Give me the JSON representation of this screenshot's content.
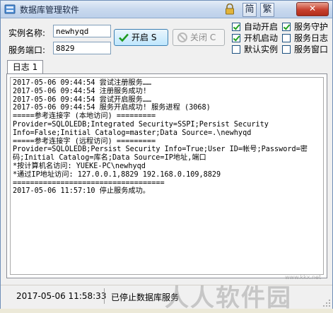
{
  "window": {
    "title": "数据库管理软件",
    "lang_simplified": "简",
    "lang_traditional": "繁",
    "minimize_glyph": "—",
    "maximize_glyph": "□",
    "close_glyph": "✕"
  },
  "form": {
    "instance_label": "实例名称:",
    "instance_value": "newhyqd",
    "port_label": "服务端口:",
    "port_value": "8829",
    "start_button": "开启 S",
    "stop_button": "关闭 C"
  },
  "options": [
    {
      "label": "自动开启",
      "checked": true
    },
    {
      "label": "服务守护",
      "checked": true
    },
    {
      "label": "开机启动",
      "checked": true
    },
    {
      "label": "服务日志",
      "checked": false
    },
    {
      "label": "默认实例",
      "checked": false
    },
    {
      "label": "服务窗口",
      "checked": false
    }
  ],
  "tabs": [
    {
      "label": "日志 1"
    }
  ],
  "log": [
    "2017-05-06 09:44:54 尝试注册服务……",
    "2017-05-06 09:44:54 注册服务成功!",
    "2017-05-06 09:44:54 尝试开启服务……",
    "2017-05-06 09:44:54 服务开启成功! 服务进程 (3068)",
    "=====参考连接字 (本地访问) =========",
    "Provider=SQLOLEDB;Integrated Security=SSPI;Persist Security",
    "Info=False;Initial Catalog=master;Data Source=.\\newhyqd",
    "=====参考连接字 (远程访问) =========",
    "Provider=SQLOLEDB;Persist Security Info=True;User ID=帐号;Password=密",
    "码;Initial Catalog=库名;Data Source=IP地址,端口",
    "*按计算机名访问: YUEKE-PC\\newhyqd",
    "*通过IP地址访问: 127.0.0.1,8829 192.168.0.109,8829",
    "===================================",
    "2017-05-06 11:57:10 停止服务成功。"
  ],
  "status": {
    "time": "2017-05-06 11:58:33",
    "message": "已停止数据库服务"
  },
  "watermark": {
    "text": "人人软件园",
    "url": "www.kkx.net"
  },
  "colors": {
    "titlebar": "#c9d9ee",
    "check_mark": "#21a121",
    "close": "#c7402e"
  }
}
